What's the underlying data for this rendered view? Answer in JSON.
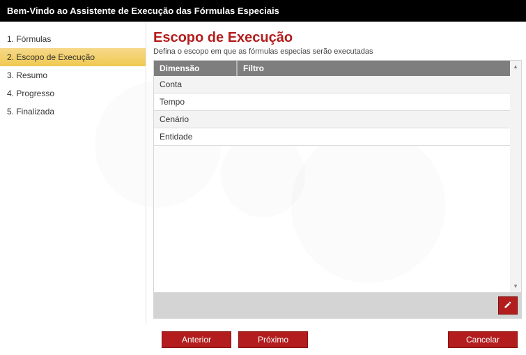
{
  "header": {
    "title": "Bem-Vindo ao Assistente de Execução das Fórmulas Especiais"
  },
  "sidebar": {
    "items": [
      {
        "label": "1. Fórmulas"
      },
      {
        "label": "2. Escopo de Execução"
      },
      {
        "label": "3. Resumo"
      },
      {
        "label": "4. Progresso"
      },
      {
        "label": "5. Finalizada"
      }
    ],
    "activeIndex": 1
  },
  "main": {
    "title": "Escopo de Execução",
    "subtitle": "Defina o escopo em que as fórmulas especias serão executadas",
    "table": {
      "headers": {
        "dimension": "Dimensão",
        "filter": "Filtro"
      },
      "rows": [
        {
          "dimension": "Conta",
          "filter": ""
        },
        {
          "dimension": "Tempo",
          "filter": ""
        },
        {
          "dimension": "Cenário",
          "filter": ""
        },
        {
          "dimension": "Entidade",
          "filter": ""
        }
      ]
    }
  },
  "footer": {
    "prev": "Anterior",
    "next": "Próximo",
    "cancel": "Cancelar"
  },
  "icons": {
    "edit": "pencil-icon"
  }
}
